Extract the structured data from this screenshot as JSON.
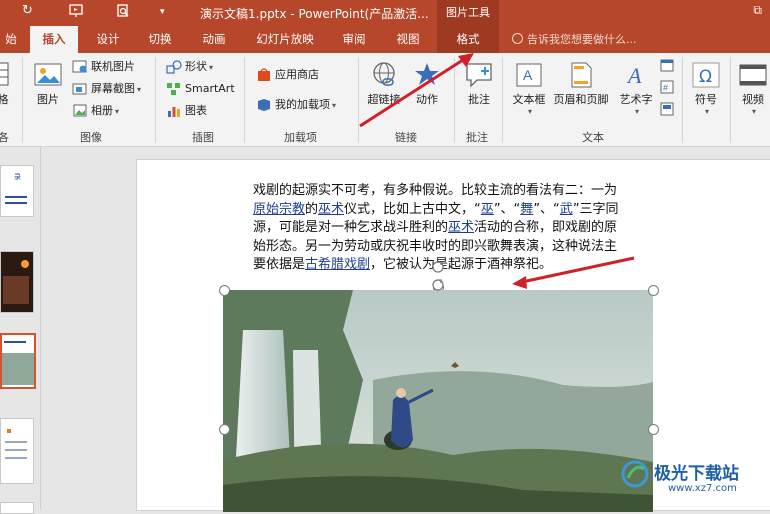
{
  "app": {
    "doc_title": "演示文稿1.pptx - PowerPoint(产品激活...",
    "tool_context": "图片工具",
    "restore_symbol": "⧉"
  },
  "tabs": [
    {
      "label": "始"
    },
    {
      "label": "插入"
    },
    {
      "label": "设计"
    },
    {
      "label": "切换"
    },
    {
      "label": "动画"
    },
    {
      "label": "幻灯片放映"
    },
    {
      "label": "审阅"
    },
    {
      "label": "视图"
    },
    {
      "label": "格式"
    }
  ],
  "tell_me": "告诉我您想要做什么...",
  "ribbon": {
    "edge_left_label": "格",
    "edge_left_group": "各",
    "images": {
      "picture": "图片",
      "online_picture": "联机图片",
      "screenshot": "屏幕截图",
      "album": "相册",
      "group": "图像"
    },
    "illustrations": {
      "shapes": "形状",
      "smartart": "SmartArt",
      "chart": "图表",
      "group": "插图"
    },
    "addins": {
      "store": "应用商店",
      "my_addins": "我的加载项",
      "group": "加载项"
    },
    "links": {
      "hyperlink": "超链接",
      "action": "动作",
      "group": "链接"
    },
    "comments": {
      "comment": "批注",
      "group": "批注"
    },
    "text": {
      "textbox": "文本框",
      "header_footer": "页眉和页脚",
      "wordart": "艺术字",
      "group": "文本"
    },
    "symbols": {
      "symbol": "符号"
    },
    "media": {
      "video": "视频"
    }
  },
  "slide": {
    "p1": "戏剧的起源实不可考，有多种假说。比较主流的看法有二：一为",
    "link1": "原始宗教",
    "p2": "的",
    "link2": "巫术",
    "p3": "仪式，比如上古中文，“",
    "link3": "巫",
    "p4": "”、“",
    "link4": "舞",
    "p5": "”、“",
    "link5": "武",
    "p6": "”三字同源，可能是对一种乞求战斗胜利的",
    "link6": "巫术",
    "p7": "活动的合称，即戏剧的原始形态。另一为劳动或庆祝丰收时的即兴歌舞表演，这种说法主要依据是",
    "link7": "古希腊戏剧",
    "p8": "，它被认为是起源于酒神祭祀。"
  },
  "thumbnails": {
    "t1_glyph": "录"
  },
  "watermark": {
    "brand": "极光下载站",
    "url": "www.xz7.com"
  },
  "colors": {
    "accent": "#b7472a",
    "accent_dark": "#9e3a22",
    "arrow": "#d0202a"
  }
}
